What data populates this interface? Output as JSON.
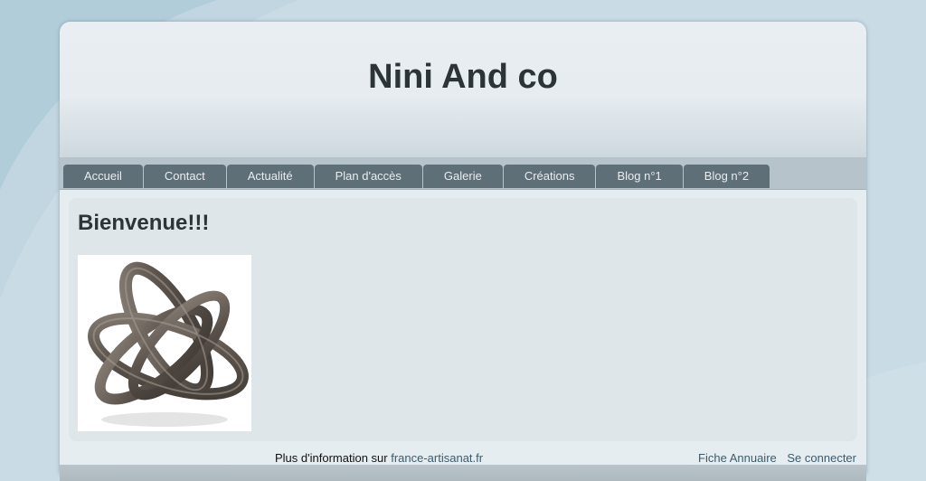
{
  "site": {
    "title": "Nini And co"
  },
  "nav": {
    "items": [
      {
        "label": "Accueil"
      },
      {
        "label": "Contact"
      },
      {
        "label": "Actualité"
      },
      {
        "label": "Plan d'accès"
      },
      {
        "label": "Galerie"
      },
      {
        "label": "Créations"
      },
      {
        "label": "Blog n°1"
      },
      {
        "label": "Blog n°2"
      }
    ]
  },
  "main": {
    "heading": "Bienvenue!!!",
    "image_icon": "metal-knot-sculpture"
  },
  "footer": {
    "info_text": "Plus d'information sur",
    "info_link": "france-artisanat.fr",
    "links": [
      {
        "label": "Fiche Annuaire"
      },
      {
        "label": "Se connecter"
      }
    ]
  },
  "colors": {
    "nav_tab": "#5e6f78",
    "page_bg": "#c9dbe5",
    "title_text": "#2c3438",
    "link": "#3d5a6b"
  }
}
